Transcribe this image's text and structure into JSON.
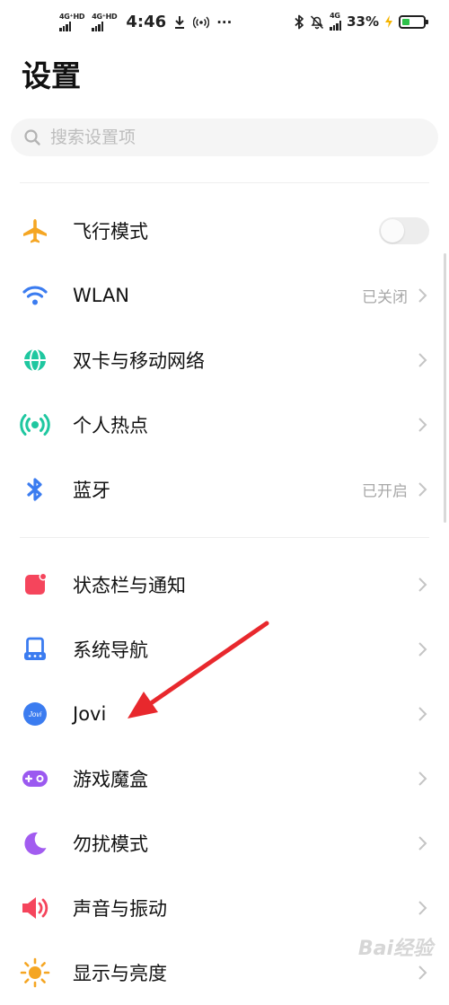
{
  "status_bar": {
    "sim1_network": "4G⁺HD",
    "sim2_network": "4G⁺HD",
    "time": "4:46",
    "more": "···",
    "right_network": "4G",
    "battery_percent": "33%",
    "battery_level": 0.33,
    "battery_color": "#2ec24a",
    "charging_color": "#f5b400"
  },
  "page": {
    "title": "设置"
  },
  "search": {
    "placeholder": "搜索设置项"
  },
  "groups": [
    {
      "items": [
        {
          "id": "airplane",
          "label": "飞行模式",
          "icon": "airplane-icon",
          "icon_color": "#f5a623",
          "control": "toggle",
          "toggle_on": false
        },
        {
          "id": "wlan",
          "label": "WLAN",
          "icon": "wifi-icon",
          "icon_color": "#3b7cf0",
          "value": "已关闭",
          "control": "chevron"
        },
        {
          "id": "dual-sim",
          "label": "双卡与移动网络",
          "icon": "globe-icon",
          "icon_color": "#1fc7a0",
          "control": "chevron"
        },
        {
          "id": "hotspot",
          "label": "个人热点",
          "icon": "hotspot-icon",
          "icon_color": "#1fc7a0",
          "control": "chevron"
        },
        {
          "id": "bluetooth",
          "label": "蓝牙",
          "icon": "bluetooth-icon",
          "icon_color": "#3b7cf0",
          "value": "已开启",
          "control": "chevron"
        }
      ]
    },
    {
      "items": [
        {
          "id": "status-bar-notification",
          "label": "状态栏与通知",
          "icon": "notification-icon",
          "icon_color": "#f5455c",
          "control": "chevron"
        },
        {
          "id": "system-navigation",
          "label": "系统导航",
          "icon": "navigation-icon",
          "icon_color": "#3b7cf0",
          "control": "chevron"
        },
        {
          "id": "jovi",
          "label": "Jovi",
          "icon": "jovi-icon",
          "icon_text": "Jovi",
          "icon_color": "#3b7cf0",
          "control": "chevron"
        },
        {
          "id": "game-box",
          "label": "游戏魔盒",
          "icon": "gamepad-icon",
          "icon_color": "#9b59f0",
          "control": "chevron"
        },
        {
          "id": "do-not-disturb",
          "label": "勿扰模式",
          "icon": "moon-icon",
          "icon_color": "#a25cf0",
          "control": "chevron"
        },
        {
          "id": "sound-vibration",
          "label": "声音与振动",
          "icon": "speaker-icon",
          "icon_color": "#f5455c",
          "control": "chevron"
        },
        {
          "id": "display-brightness",
          "label": "显示与亮度",
          "icon": "sun-icon",
          "icon_color": "#f5a623",
          "control": "chevron"
        }
      ]
    }
  ],
  "annotation": {
    "arrow_color": "#e8282d"
  },
  "watermark": {
    "text": "Bai经验"
  }
}
